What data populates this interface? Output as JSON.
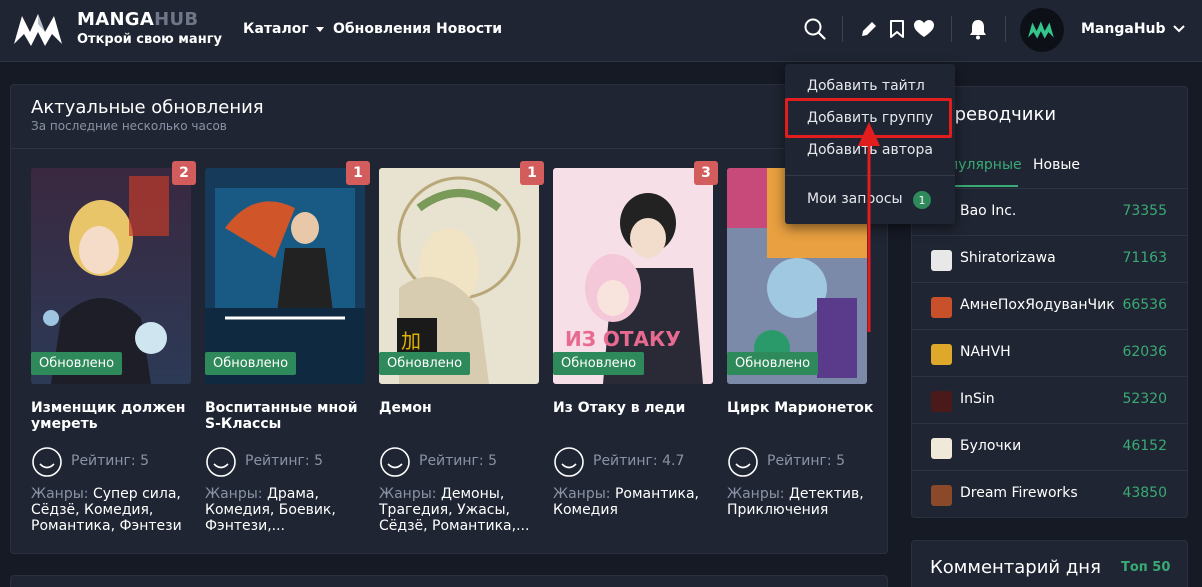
{
  "header": {
    "brand_main": "MANGA",
    "brand_accent": "HUB",
    "tagline": "Открой свою мангу",
    "nav": [
      "Каталог",
      "Обновления",
      "Новости"
    ],
    "username": "MangaHub",
    "icons": [
      "search-icon",
      "pencil-icon",
      "bookmark-icon",
      "heart-icon",
      "bell-icon",
      "chevron-down-icon"
    ]
  },
  "updates": {
    "title": "Актуальные обновления",
    "subtitle": "За последние несколько часов",
    "updated_label": "Обновлено",
    "genres_label": "Жанры:",
    "items": [
      {
        "title": "Изменщик должен умереть",
        "badge": "2",
        "rating": "Рейтинг: 5",
        "genres": "Супер сила, Сёдзё, Комедия, Романтика, Фэнтези"
      },
      {
        "title": "Воспитанные мной S-Классы",
        "badge": "1",
        "rating": "Рейтинг: 5",
        "genres": "Драма, Комедия, Боевик, Фэнтези,..."
      },
      {
        "title": "Демон",
        "badge": "1",
        "rating": "Рейтинг: 5",
        "genres": "Демоны, Трагедия, Ужасы, Сёдзё, Романтика,..."
      },
      {
        "title": "Из Отаку в леди",
        "badge": "3",
        "rating": "Рейтинг: 4.7",
        "genres": "Романтика, Комедия"
      },
      {
        "title": "Цирк Марионеток",
        "badge": "",
        "rating": "Рейтинг: 5",
        "genres": "Детектив, Приключения"
      }
    ]
  },
  "translators": {
    "title": "Переводчики",
    "tabs": [
      "Популярные",
      "Новые"
    ],
    "rows": [
      {
        "name": "Bao Inc.",
        "score": "73355"
      },
      {
        "name": "Shiratorizawa",
        "score": "71163"
      },
      {
        "name": "АмнеПохЯодуванЧик",
        "score": "66536"
      },
      {
        "name": "NAHVH",
        "score": "62036"
      },
      {
        "name": "InSin",
        "score": "52320"
      },
      {
        "name": "Булочки",
        "score": "46152"
      },
      {
        "name": "Dream Fireworks",
        "score": "43850"
      }
    ]
  },
  "comments": {
    "title": "Комментарий дня",
    "link": "Топ 50"
  },
  "dropdown": {
    "items": [
      "Добавить тайтл",
      "Добавить группу",
      "Добавить автора",
      "Мои запросы"
    ],
    "requests_count": "1"
  },
  "colors": {
    "bg": "#161a25",
    "panel": "#1f2532",
    "accent_green": "#2e8a5a",
    "badge_red": "#d35c5c",
    "highlight_red": "#e11d1d",
    "score_green": "#3aaa75"
  }
}
